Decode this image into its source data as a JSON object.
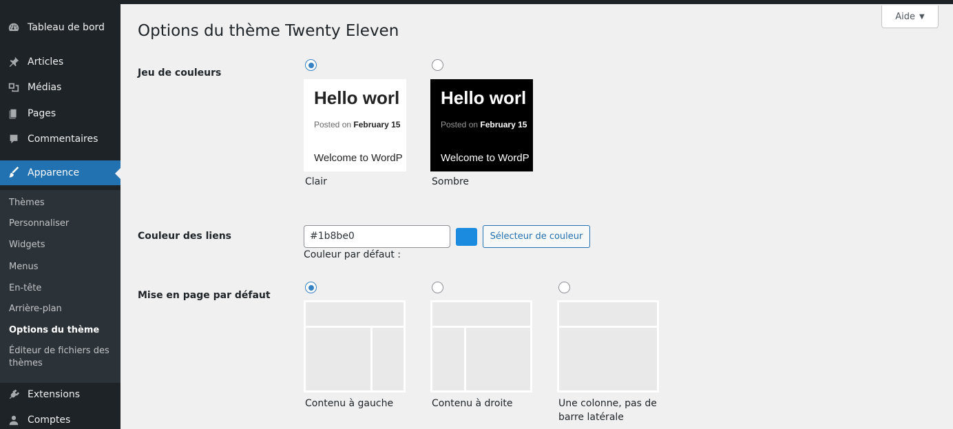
{
  "sidebar": {
    "top_items": [
      {
        "label": "Tableau de bord",
        "icon": "dashboard-icon"
      },
      {
        "label": "Articles",
        "icon": "pin-icon"
      },
      {
        "label": "Médias",
        "icon": "media-icon"
      },
      {
        "label": "Pages",
        "icon": "page-icon"
      },
      {
        "label": "Commentaires",
        "icon": "comment-icon"
      }
    ],
    "active_item": {
      "label": "Apparence",
      "icon": "paintbrush-icon"
    },
    "submenu": [
      {
        "label": "Thèmes"
      },
      {
        "label": "Personnaliser"
      },
      {
        "label": "Widgets"
      },
      {
        "label": "Menus"
      },
      {
        "label": "En-tête"
      },
      {
        "label": "Arrière-plan"
      },
      {
        "label": "Options du thème"
      },
      {
        "label": "Éditeur de fichiers des thèmes"
      }
    ],
    "bottom_items": [
      {
        "label": "Extensions",
        "icon": "plugin-icon"
      },
      {
        "label": "Comptes",
        "icon": "user-icon"
      }
    ]
  },
  "help_button": {
    "label": "Aide",
    "icon": "caret-down-icon"
  },
  "page_title": "Options du thème Twenty Eleven",
  "color_scheme": {
    "label": "Jeu de couleurs",
    "options": [
      {
        "label": "Clair",
        "checked": true,
        "preview_title": "Hello worl",
        "preview_meta_prefix": "Posted on",
        "preview_meta_date": "February 15",
        "preview_body": "Welcome to WordP"
      },
      {
        "label": "Sombre",
        "checked": false,
        "preview_title": "Hello worl",
        "preview_meta_prefix": "Posted on",
        "preview_meta_date": "February 15",
        "preview_body": "Welcome to WordP"
      }
    ]
  },
  "link_color": {
    "label": "Couleur des liens",
    "value": "#1b8be0",
    "swatch_color": "#1b8be0",
    "picker_label": "Sélecteur de couleur",
    "default_label": "Couleur par défaut :"
  },
  "default_layout": {
    "label": "Mise en page par défaut",
    "options": [
      {
        "label": "Contenu à gauche",
        "checked": true
      },
      {
        "label": "Contenu à droite",
        "checked": false
      },
      {
        "label": "Une colonne, pas de barre latérale",
        "checked": false
      }
    ]
  }
}
